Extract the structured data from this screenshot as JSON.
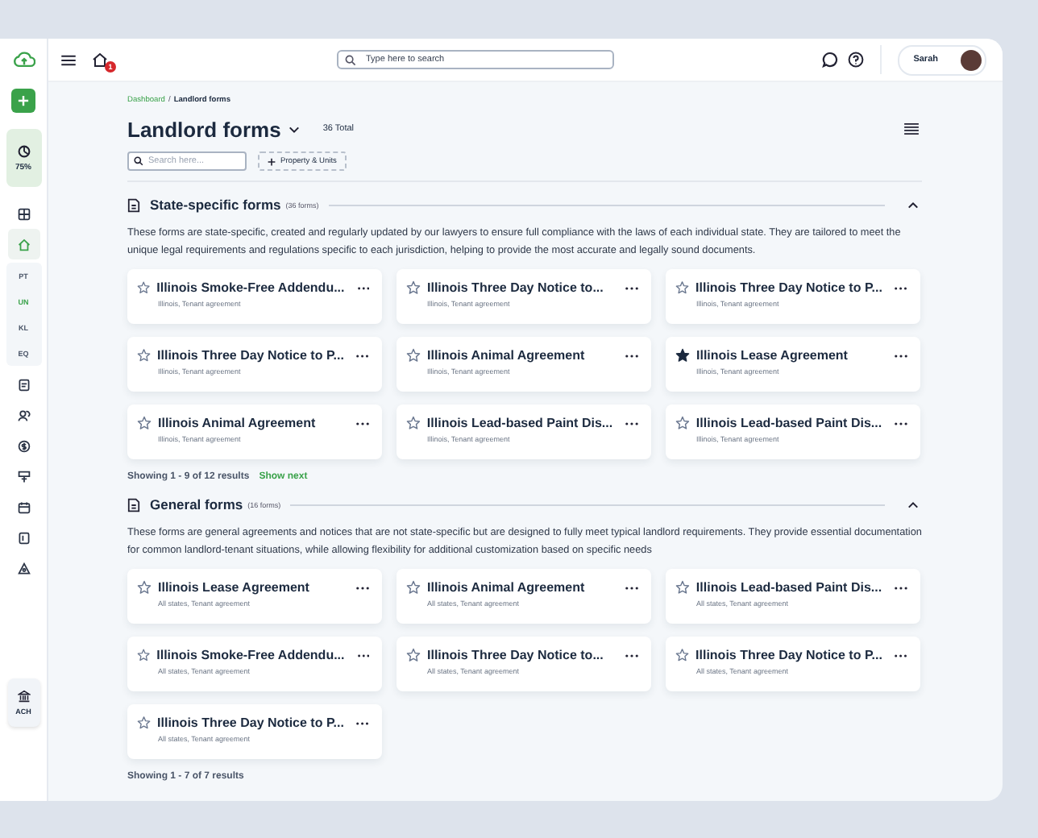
{
  "sidebar": {
    "progress": {
      "label": "75%"
    },
    "nav_items": [
      {
        "kind": "icon",
        "selected": false
      },
      {
        "kind": "icon",
        "selected": true
      },
      {
        "kind": "code",
        "label": "PT",
        "selected": false
      },
      {
        "kind": "code",
        "label": "UN",
        "selected": true
      },
      {
        "kind": "code",
        "label": "KL",
        "selected": false
      },
      {
        "kind": "code",
        "label": "EQ",
        "selected": false
      },
      {
        "kind": "icon",
        "selected": false
      },
      {
        "kind": "icon",
        "selected": false
      },
      {
        "kind": "icon",
        "selected": false
      },
      {
        "kind": "icon",
        "selected": false
      },
      {
        "kind": "icon",
        "selected": false
      },
      {
        "kind": "icon",
        "selected": false
      },
      {
        "kind": "icon",
        "selected": false
      }
    ],
    "bottom_item": {
      "label": "ACH"
    }
  },
  "topbar": {
    "notification_count": "1",
    "search": {
      "placeholder": "Type here to search"
    },
    "user": {
      "name": "Sarah"
    }
  },
  "breadcrumb": {
    "items": [
      "Dashboard",
      "Landlord forms"
    ],
    "separator": "/"
  },
  "page": {
    "title": "Landlord forms",
    "total": "36 Total",
    "search": {
      "placeholder": "Search here..."
    },
    "filter_button": "Property & Units"
  },
  "sections": [
    {
      "title": "State-specific forms",
      "count": "(36 forms)",
      "expanded": true,
      "description": "These forms are state-specific, created and regularly updated by our lawyers to ensure full compliance with the laws of each individual state. They are tailored to meet the unique legal requirements and regulations specific to each jurisdiction, helping to provide the most accurate and legally sound documents.",
      "cards": [
        {
          "title": "Illinois Smoke-Free Addendu...",
          "subtitle": "Illinois, Tenant agreement",
          "starred": false
        },
        {
          "title": "Illinois Three Day Notice to...",
          "subtitle": "Illinois, Tenant agreement",
          "starred": false
        },
        {
          "title": "Illinois Three Day Notice to P...",
          "subtitle": "Illinois, Tenant agreement",
          "starred": false
        },
        {
          "title": "Illinois Three Day Notice to P...",
          "subtitle": "Illinois, Tenant agreement",
          "starred": false
        },
        {
          "title": "Illinois Animal Agreement",
          "subtitle": "Illinois, Tenant agreement",
          "starred": false
        },
        {
          "title": "Illinois Lease Agreement",
          "subtitle": "Illinois, Tenant agreement",
          "starred": true
        },
        {
          "title": "Illinois Animal Agreement",
          "subtitle": "Illinois, Tenant agreement",
          "starred": false
        },
        {
          "title": "Illinois Lead-based Paint Dis...",
          "subtitle": "Illinois, Tenant agreement",
          "starred": false
        },
        {
          "title": "Illinois Lead-based Paint Dis...",
          "subtitle": "Illinois, Tenant agreement",
          "starred": false
        }
      ],
      "footer": "Showing 1 - 9 of 12 results",
      "more_link": "Show next"
    },
    {
      "title": "General forms",
      "count": "(16 forms)",
      "expanded": true,
      "description": "These forms are general agreements and notices that are not state-specific but are designed to fully meet typical landlord requirements. They provide essential documentation for common landlord-tenant situations, while allowing flexibility for additional customization based on specific needs",
      "cards": [
        {
          "title": "Illinois Lease Agreement",
          "subtitle": "All states, Tenant agreement",
          "starred": false
        },
        {
          "title": "Illinois Animal Agreement",
          "subtitle": "All states, Tenant agreement",
          "starred": false
        },
        {
          "title": "Illinois Lead-based Paint Dis...",
          "subtitle": "All states, Tenant agreement",
          "starred": false
        },
        {
          "title": "Illinois Smoke-Free Addendu...",
          "subtitle": "All states, Tenant agreement",
          "starred": false
        },
        {
          "title": "Illinois Three Day Notice to...",
          "subtitle": "All states, Tenant agreement",
          "starred": false
        },
        {
          "title": "Illinois Three Day Notice to P...",
          "subtitle": "All states, Tenant agreement",
          "starred": false
        },
        {
          "title": "Illinois Three Day Notice to P...",
          "subtitle": "All states, Tenant agreement",
          "starred": false
        }
      ],
      "footer": "Showing 1 - 7 of 7 results"
    }
  ]
}
